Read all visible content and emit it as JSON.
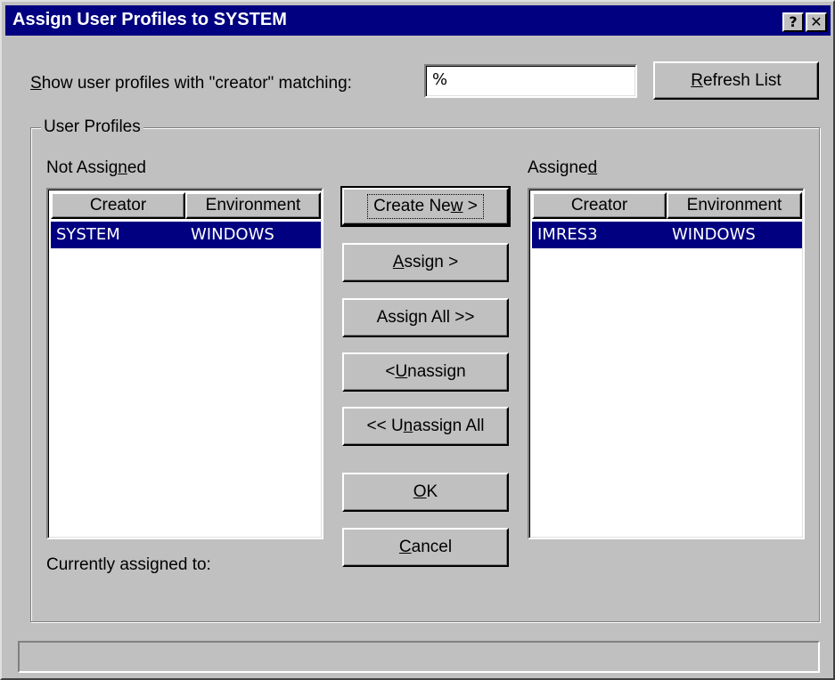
{
  "window": {
    "title": "Assign User Profiles to SYSTEM",
    "help_glyph": "?",
    "close_glyph": "✕"
  },
  "filter": {
    "label_prefix": "S",
    "label_rest": "how user profiles with \"creator\" matching:",
    "value": "%",
    "refresh_prefix": "R",
    "refresh_rest": "efresh List"
  },
  "group": {
    "legend": "User Profiles"
  },
  "not_assigned": {
    "label_pre": "Not Assig",
    "label_u": "n",
    "label_post": "ed",
    "columns": [
      "Creator",
      "Environment"
    ],
    "rows": [
      {
        "creator": "SYSTEM",
        "environment": "WINDOWS"
      }
    ]
  },
  "assigned": {
    "label_pre": "Assigne",
    "label_u": "d",
    "label_post": "",
    "columns": [
      "Creator",
      "Environment"
    ],
    "rows": [
      {
        "creator": "IMRES3",
        "environment": "WINDOWS"
      }
    ]
  },
  "buttons": {
    "create_new": {
      "pre": "Create Ne",
      "u": "w",
      "post": " >"
    },
    "assign": {
      "pre": "",
      "u": "A",
      "post": "ssign >"
    },
    "assign_all": {
      "pre": "Assi",
      "u": "g",
      "post": "n All >>"
    },
    "unassign": {
      "pre": "< ",
      "u": "U",
      "post": "nassign"
    },
    "unassign_all": {
      "pre": "<< U",
      "u": "n",
      "post": "assign All"
    },
    "ok": {
      "pre": "",
      "u": "O",
      "post": "K"
    },
    "cancel": {
      "pre": "",
      "u": "C",
      "post": "ancel"
    }
  },
  "currently_assigned_label": "Currently assigned to:",
  "status_text": ""
}
